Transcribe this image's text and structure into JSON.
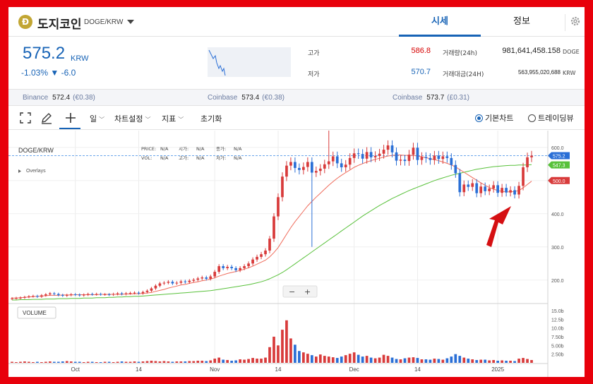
{
  "header": {
    "logo_letter": "Đ",
    "coin_name": "도지코인",
    "pair": "DOGE/KRW",
    "tabs": [
      {
        "label": "시세"
      },
      {
        "label": "정보"
      }
    ]
  },
  "summary": {
    "price": "575.2",
    "price_unit": "KRW",
    "change": "-1.03% ▼ -6.0",
    "high_label": "고가",
    "high_value": "586.8",
    "low_label": "저가",
    "low_value": "570.7",
    "vol_label": "거래량(24h)",
    "vol_value": "981,641,458.158",
    "vol_unit": "DOGE",
    "amt_label": "거래대금(24H)",
    "amt_value": "563,955,020,688",
    "amt_unit": "KRW"
  },
  "exchanges": [
    {
      "name": "Binance",
      "price": "572.4",
      "premium": "(€0.38)"
    },
    {
      "name": "Coinbase",
      "price": "573.4",
      "premium": "(€0.38)"
    },
    {
      "name": "Coinbase",
      "price": "573.7",
      "premium": "(£0.31)"
    }
  ],
  "toolbar": {
    "period": "일",
    "chart_settings": "차트설정",
    "indicators": "지표",
    "reset": "초기화",
    "view_basic": "기본차트",
    "view_tradingview": "트레이딩뷰"
  },
  "legend": {
    "symbol": "DOGE/KRW",
    "overlays": "Overlays",
    "price_row": [
      [
        "PRICE:",
        "N/A"
      ],
      [
        "시가:",
        "N/A"
      ],
      [
        "종가:",
        "N/A"
      ]
    ],
    "vol_row": [
      [
        "VOL:",
        "N/A"
      ],
      [
        "고가:",
        "N/A"
      ],
      [
        "저가:",
        "N/A"
      ]
    ],
    "volume_label": "VOLUME",
    "zoom_out": "−",
    "zoom_in": "+"
  },
  "colors": {
    "up": "#d83b3b",
    "down": "#2a6fd6",
    "ma_short": "#ef6b5b",
    "ma_long": "#58c13a",
    "accent": "#1763b6",
    "arrow": "#d50f12"
  },
  "chart_data": {
    "type": "candlestick",
    "y_ticks": [
      "600.0",
      "500.0",
      "400.0",
      "300.0",
      "200.0"
    ],
    "y_tick_values": [
      600,
      500,
      400,
      300,
      200
    ],
    "ylim": [
      140,
      640
    ],
    "x_tick_labels": [
      "Oct",
      "14",
      "Nov",
      "14",
      "Dec",
      "14",
      "2025"
    ],
    "volume_ticks": [
      "15.0b",
      "12.5b",
      "10.0b",
      "7.50b",
      "5.00b",
      "2.50b"
    ],
    "volume_tick_values": [
      15,
      12.5,
      10,
      7.5,
      5,
      2.5
    ],
    "price_tags": [
      {
        "label": "575.2",
        "value": 575.2,
        "color": "#2a6fd6"
      },
      {
        "label": "547.3",
        "value": 547.3,
        "color": "#58c13a"
      },
      {
        "label": "500.0",
        "value": 500.0,
        "color": "#d83b3b"
      }
    ],
    "closes": [
      145,
      146,
      147,
      149,
      151,
      152,
      150,
      154,
      157,
      160,
      158,
      155,
      153,
      155,
      157,
      156,
      154,
      156,
      158,
      157,
      158,
      157,
      157,
      156,
      158,
      160,
      158,
      160,
      161,
      162,
      160,
      164,
      168,
      175,
      183,
      190,
      192,
      195,
      190,
      192,
      196,
      194,
      198,
      201,
      205,
      208,
      204,
      211,
      225,
      242,
      236,
      240,
      236,
      230,
      236,
      242,
      250,
      262,
      270,
      278,
      289,
      325,
      392,
      450,
      512,
      545,
      556,
      538,
      532,
      541,
      556,
      524,
      529,
      536,
      549,
      558,
      573,
      552,
      540,
      548,
      568,
      582,
      580,
      566,
      586,
      570,
      574,
      581,
      593,
      606,
      585,
      560,
      563,
      559,
      578,
      599,
      562,
      571,
      568,
      562,
      575,
      565,
      573,
      568,
      547,
      522,
      465,
      488,
      481,
      492,
      462,
      482,
      468,
      476,
      486,
      463,
      478,
      464,
      471,
      458,
      484,
      540,
      570,
      575
    ],
    "volumes": [
      0.3,
      0.2,
      0.3,
      0.4,
      0.3,
      0.2,
      0.3,
      0.2,
      0.3,
      0.4,
      0.3,
      0.3,
      0.4,
      0.5,
      0.4,
      0.3,
      0.3,
      0.2,
      0.3,
      0.3,
      0.2,
      0.2,
      0.3,
      0.3,
      0.2,
      0.3,
      0.4,
      0.3,
      0.3,
      0.4,
      0.3,
      0.4,
      0.5,
      0.6,
      0.5,
      0.4,
      0.5,
      0.4,
      0.3,
      0.4,
      0.4,
      0.4,
      0.5,
      0.5,
      0.6,
      0.6,
      0.5,
      0.7,
      1.2,
      1.5,
      0.9,
      0.8,
      0.6,
      0.7,
      1.0,
      0.9,
      1.1,
      1.4,
      1.2,
      1.2,
      1.5,
      4.5,
      7.5,
      5.0,
      9.5,
      12.2,
      7.0,
      5.2,
      3.4,
      3.0,
      2.6,
      2.2,
      1.8,
      2.4,
      2.0,
      1.8,
      1.6,
      1.4,
      1.8,
      2.2,
      2.6,
      3.0,
      2.3,
      1.8,
      2.0,
      1.5,
      1.3,
      1.5,
      2.3,
      2.0,
      1.5,
      1.1,
      1.0,
      1.3,
      1.5,
      1.6,
      1.4,
      1.0,
      1.0,
      0.9,
      1.2,
      1.1,
      0.9,
      1.3,
      1.8,
      2.5,
      2.0,
      1.5,
      1.2,
      1.0,
      0.8,
      0.9,
      0.9,
      0.7,
      0.8,
      0.6,
      0.7,
      0.6,
      0.6,
      0.5,
      1.2,
      1.4,
      1.1,
      0.8
    ],
    "ma_short": [
      146,
      146,
      147,
      148,
      149,
      150,
      151,
      152,
      153,
      154,
      154,
      154,
      155,
      155,
      155,
      156,
      156,
      156,
      156,
      156,
      156,
      157,
      157,
      157,
      157,
      157,
      157,
      158,
      158,
      159,
      159,
      160,
      161,
      163,
      166,
      169,
      172,
      176,
      179,
      182,
      185,
      187,
      190,
      193,
      195,
      198,
      200,
      203,
      207,
      212,
      216,
      220,
      223,
      226,
      229,
      233,
      237,
      242,
      248,
      254,
      260,
      270,
      283,
      298,
      318,
      338,
      358,
      376,
      392,
      408,
      424,
      437,
      450,
      462,
      474,
      486,
      497,
      507,
      516,
      524,
      532,
      540,
      546,
      551,
      556,
      560,
      564,
      567,
      571,
      574,
      576,
      577,
      577,
      576,
      576,
      576,
      574,
      572,
      569,
      566,
      563,
      560,
      556,
      552,
      547,
      541,
      533,
      525,
      517,
      509,
      501,
      493,
      486,
      479,
      474,
      470,
      467,
      466,
      466,
      467,
      470,
      478,
      488,
      498
    ],
    "ma_long": [
      140,
      140,
      141,
      141,
      141,
      142,
      142,
      142,
      143,
      143,
      143,
      144,
      144,
      144,
      145,
      145,
      145,
      146,
      146,
      146,
      147,
      147,
      147,
      148,
      148,
      149,
      149,
      150,
      150,
      151,
      151,
      152,
      153,
      154,
      155,
      156,
      157,
      158,
      159,
      160,
      161,
      162,
      163,
      164,
      165,
      166,
      167,
      168,
      170,
      172,
      174,
      176,
      178,
      180,
      182,
      184,
      186,
      189,
      192,
      195,
      199,
      204,
      210,
      216,
      223,
      231,
      240,
      249,
      258,
      267,
      276,
      285,
      294,
      303,
      312,
      321,
      330,
      339,
      348,
      357,
      366,
      375,
      384,
      393,
      401,
      409,
      417,
      425,
      432,
      439,
      446,
      452,
      458,
      464,
      470,
      475,
      480,
      485,
      490,
      495,
      500,
      504,
      508,
      512,
      516,
      519,
      522,
      525,
      528,
      531,
      534,
      536,
      538,
      540,
      542,
      543,
      544,
      545,
      546,
      546,
      547,
      547,
      547,
      548
    ]
  }
}
